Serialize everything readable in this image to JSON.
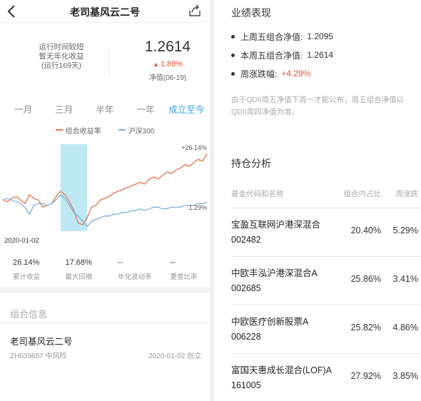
{
  "nav": {
    "title": "老司基风云二号"
  },
  "summary": {
    "desc_lines": [
      "运行时间较短",
      "暂无年化收益",
      "(运行169天)"
    ],
    "value": "1.2614",
    "change": "1.89%",
    "date_label": "净值(06-19)"
  },
  "periods": [
    "一月",
    "三月",
    "半年",
    "一年",
    "成立至今"
  ],
  "active_period_index": 4,
  "legend": {
    "portfolio": "组合收益率",
    "index": "沪深300"
  },
  "colors": {
    "portfolio": "#e8734a",
    "index": "#7fb0d6",
    "highlight": "#bfe8f5",
    "up": "#e8512b",
    "active": "#3aa1e6"
  },
  "chart_data": {
    "type": "line",
    "start_date": "2020-01-02",
    "series": [
      {
        "name": "组合收益率",
        "end_label": "+26.14%",
        "values": [
          0,
          -1,
          1,
          2,
          0,
          -2,
          3,
          1,
          0,
          -4,
          -3,
          -2,
          2,
          5,
          3,
          -1,
          -6,
          -13,
          -14,
          -10,
          -4,
          -3,
          0,
          1,
          2,
          4,
          5,
          6,
          7,
          8,
          9,
          10,
          9,
          12,
          13,
          12,
          14,
          16,
          15,
          17,
          18,
          20,
          19,
          21,
          23,
          22,
          26.14
        ]
      },
      {
        "name": "沪深300",
        "end_label": "-1.29%",
        "values": [
          0,
          1,
          0,
          -1,
          -2,
          -4,
          -8,
          -3,
          -2,
          -2,
          -3,
          -2,
          0,
          3,
          1,
          -3,
          -7,
          -9,
          -12,
          -15,
          -12,
          -11,
          -10,
          -9,
          -9,
          -8,
          -8,
          -7,
          -7,
          -6,
          -6,
          -5,
          -6,
          -5,
          -4,
          -4,
          -5,
          -5,
          -4,
          -4,
          -4,
          -3,
          -3,
          -3,
          -2,
          -2,
          -1.29
        ]
      }
    ],
    "highlight_range": [
      13,
      19
    ],
    "ylim": [
      -16,
      30
    ]
  },
  "stats": [
    {
      "value": "26.14%",
      "label": "累计收益"
    },
    {
      "value": "17.68%",
      "label": "最大回撤"
    },
    {
      "value": "--",
      "label": "年化波动率"
    },
    {
      "value": "--",
      "label": "夏普比率"
    }
  ],
  "group": {
    "header": "组合信息",
    "name": "老司基风云二号",
    "sub": "ZH039657 中风险",
    "created": "2020-01-02 创立"
  },
  "performance": {
    "title": "业绩表现",
    "items": [
      {
        "label": "上周五组合净值:",
        "value": "1.2095"
      },
      {
        "label": "本周五组合净值:",
        "value": "1.2614"
      },
      {
        "label": "周涨跌幅:",
        "value": "+4.29%"
      }
    ],
    "note": "由于QDII周五净值下周一才能公布，周五组合净值以QDII周四净值为准。"
  },
  "holdings": {
    "title": "持仓分析",
    "headers": [
      "基金代码和名称",
      "组合内占比",
      "周涨跌"
    ],
    "rows": [
      {
        "name": "宝盈互联网沪港深混合",
        "code": "002482",
        "weight": "20.40%",
        "change": "5.29%"
      },
      {
        "name": "中欧丰泓沪港深混合A",
        "code": "002685",
        "weight": "25.86%",
        "change": "3.41%"
      },
      {
        "name": "中欧医疗创新股票A",
        "code": "006228",
        "weight": "25.82%",
        "change": "4.86%"
      },
      {
        "name": "富国天惠成长混合(LOF)A",
        "code": "161005",
        "weight": "27.92%",
        "change": "3.85%"
      }
    ]
  }
}
